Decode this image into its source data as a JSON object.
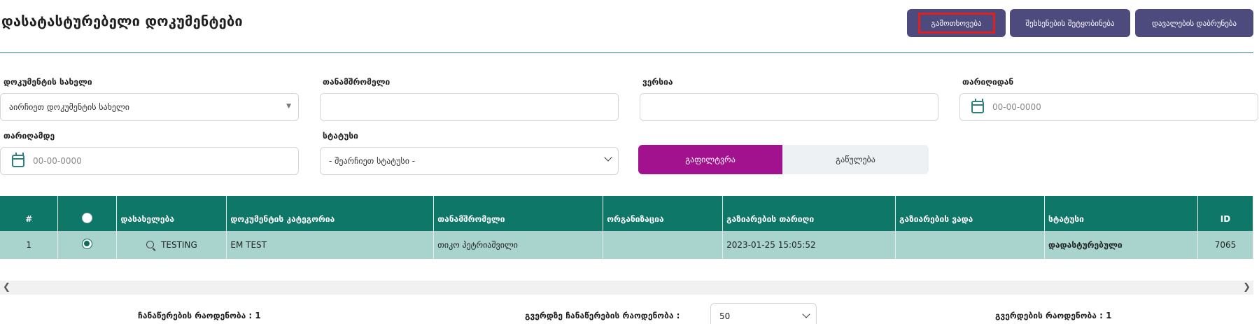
{
  "page": {
    "title": "დასატასტურებელი დოკუმენტები"
  },
  "actions": {
    "export_label": "გამოთხოვება",
    "notify_label": "შეხსენების შეტყობინება",
    "return_label": "დავალების დაბრუნება"
  },
  "filters": {
    "doc_name": {
      "label": "დოკუმენტის სახელი",
      "value": "აირჩიეთ დოკუმენტის სახელი"
    },
    "employee": {
      "label": "თანამშრომელი",
      "value": ""
    },
    "version": {
      "label": "ვერსია",
      "value": ""
    },
    "date_from": {
      "label": "თარიღიდან",
      "placeholder": "00-00-0000"
    },
    "date_to": {
      "label": "თარიღამდე",
      "placeholder": "00-00-0000"
    },
    "status": {
      "label": "სტატუსი",
      "value": "- შეარჩიეთ სტატუსი -"
    },
    "filter_label": "გაფილტვრა",
    "reset_label": "გაწულება"
  },
  "table": {
    "columns": [
      "#",
      "",
      "დასახელება",
      "დოკუმენტის კატეგორია",
      "თანამშრომელი",
      "ორგანიზაცია",
      "გაზიარების თარიღი",
      "გაზიარების ვადა",
      "სტატუსი",
      "ID"
    ],
    "rows": [
      {
        "num": "1",
        "name": "TESTING",
        "category": "EM TEST",
        "employee": "თიკო პეტრიაშვილი",
        "organization": "",
        "share_date": "2023-01-25 15:05:52",
        "share_deadline": "",
        "status": "დადასტურებული",
        "id": "7065"
      }
    ]
  },
  "footer": {
    "records_count": "ჩანაწერების რაოდენობა : 1",
    "per_page_label": "გვერდზე ჩანაწერების რაოდენობა :",
    "per_page_value": "50",
    "pages_count": "გვერდების რაოდენობა : 1"
  },
  "colors": {
    "header_bg": "#0f7768",
    "row_bg": "#a8d4cd",
    "top_button_bg": "#4d4a7e",
    "filter_button_bg": "#a2128f",
    "status_green": "#1a8a1a"
  }
}
